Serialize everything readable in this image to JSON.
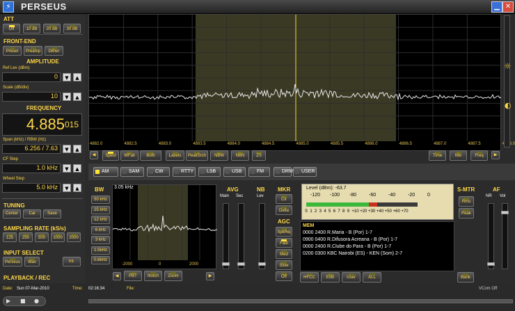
{
  "app": {
    "title": "PERSEUS"
  },
  "window": {
    "minimize_icon": "minimize-icon",
    "close_icon": "close-icon"
  },
  "att": {
    "label": "ATT",
    "buttons": [
      "Off",
      "10 dB",
      "20 dB",
      "30 dB"
    ],
    "active": 0
  },
  "frontend": {
    "label": "FRONT-END",
    "buttons": [
      "Preset",
      "Preamp",
      "Dither"
    ]
  },
  "amplitude": {
    "label": "AMPLITUDE",
    "ref_label": "Ref Lev (dBm)",
    "ref_value": "0",
    "scale_label": "Scale (dB/div)",
    "scale_value": "10"
  },
  "frequency": {
    "label": "FREQUENCY",
    "main": "4.885",
    "fine": "015",
    "span_label": "Span (kHz) / RBW (Hz)",
    "span_value": "6.256 / 7.63",
    "cf_label": "CF Step",
    "cf_value": "1.0 kHz",
    "wheel_label": "Wheel Step",
    "wheel_value": "5.0 kHz"
  },
  "tuning": {
    "label": "TUNING",
    "buttons": [
      "Center",
      "Cal",
      "Save"
    ]
  },
  "sampling": {
    "label": "SAMPLING RATE (kS/s)",
    "buttons": [
      "125",
      "250",
      "500",
      "1000",
      "2000"
    ]
  },
  "input": {
    "label": "INPUT SELECT",
    "buttons": [
      "Perseus",
      "Wav",
      "Int."
    ]
  },
  "playback": {
    "label": "PLAYBACK / REC"
  },
  "spectrum": {
    "freq_ticks": [
      "4882.0",
      "4882.5",
      "4883.0",
      "4883.5",
      "4884.0",
      "4884.5",
      "4885.0",
      "4885.5",
      "4886.0",
      "4886.5",
      "4887.0",
      "4887.5",
      "4888.0"
    ],
    "left_buttons": [
      "Spect",
      "WFall",
      "Both",
      "Labels",
      "PeakSrch",
      "NBW",
      "NBN",
      "ZS"
    ],
    "right_buttons": [
      "Time",
      "Mix",
      "Freq"
    ]
  },
  "modes": [
    "AM",
    "SAM",
    "CW",
    "RTTY",
    "LSB",
    "USB",
    "FM",
    "DRM",
    "USER"
  ],
  "active_mode": "AM",
  "bw": {
    "label": "BW",
    "buttons": [
      "50 kHz",
      "25 kHz",
      "12 kHz",
      "6 kHz",
      "3 kHz",
      "1.5kHz",
      "0.8kHz"
    ],
    "display": "3.05 kHz",
    "ticks": [
      "-2000",
      "0",
      "2000"
    ],
    "filter_buttons": [
      "PBT",
      "Notch",
      "Zoom"
    ]
  },
  "avg": {
    "label": "AVG",
    "main": "Main",
    "sec": "Sec"
  },
  "nb": {
    "label": "NB",
    "lev": "Lev"
  },
  "mkr": {
    "label": "MKR",
    "buttons": [
      "Clr",
      "Delta"
    ]
  },
  "agc": {
    "label": "AGC",
    "buttons": [
      "SpkRej",
      "Fast",
      "Med",
      "Slow",
      "Off"
    ]
  },
  "meter": {
    "level": "Level (dBm): -63.7",
    "dbm_scale": [
      "-120",
      "-100",
      "-80",
      "-60",
      "-40",
      "-20",
      "0"
    ],
    "s_scale": "S  1  2  3  4  5  6  7  8  9  +10 +20 +30 +40 +50 +60 +70"
  },
  "smtr": {
    "label": "S-MTR",
    "buttons": [
      "Rms",
      "Peak"
    ]
  },
  "af": {
    "label": "AF",
    "nr": "NR",
    "vol": "Vol"
  },
  "mem": {
    "label": "MEM",
    "rows": [
      "0000 2400 R.Maria  - B (Por)  1-7",
      "0900 0400 R.Difusora Acreana  - B (Por)  1-7",
      "0000 2400 R.Clube do Para  - B (Por)  1-7",
      "0200 0300 KBC Nairobi (ES)  - KEN (Som)  2-7"
    ],
    "buttons": [
      "HFCC",
      "EIBI",
      "User",
      "ALL"
    ],
    "bank": "Bank"
  },
  "status": {
    "date_label": "Date:",
    "date": "Sun 07-Mar-2010",
    "time_label": "Time:",
    "time": "02:16:34",
    "file_label": "File:",
    "vcom": "VCom Off"
  }
}
